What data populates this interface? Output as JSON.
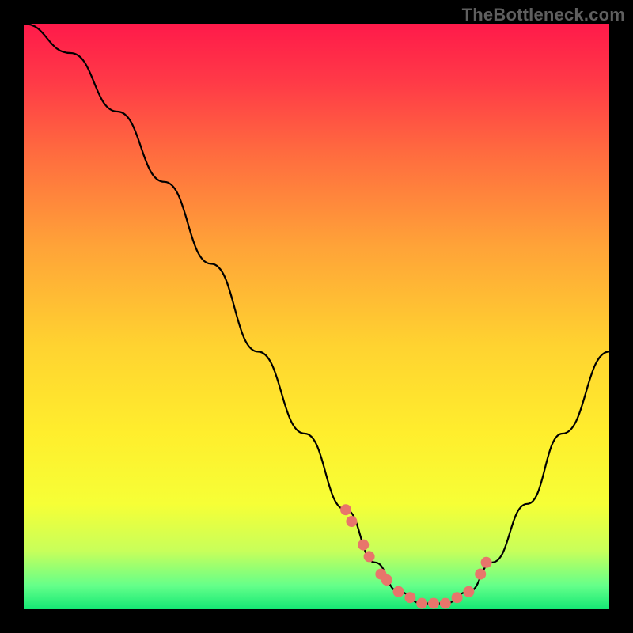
{
  "watermark": "TheBottleneck.com",
  "chart_data": {
    "type": "line",
    "title": "",
    "xlabel": "",
    "ylabel": "",
    "xlim": [
      0,
      100
    ],
    "ylim": [
      0,
      100
    ],
    "series": [
      {
        "name": "bottleneck-curve",
        "x": [
          0,
          8,
          16,
          24,
          32,
          40,
          48,
          55,
          60,
          64,
          68,
          72,
          76,
          80,
          86,
          92,
          100
        ],
        "y": [
          100,
          95,
          85,
          73,
          59,
          44,
          30,
          17,
          8,
          3,
          1,
          1,
          3,
          8,
          18,
          30,
          44
        ]
      }
    ],
    "markers": {
      "name": "highlight-points",
      "x": [
        55,
        56,
        58,
        59,
        61,
        62,
        64,
        66,
        68,
        70,
        72,
        74,
        76,
        78,
        79
      ],
      "y": [
        17,
        15,
        11,
        9,
        6,
        5,
        3,
        2,
        1,
        1,
        1,
        2,
        3,
        6,
        8
      ]
    }
  }
}
